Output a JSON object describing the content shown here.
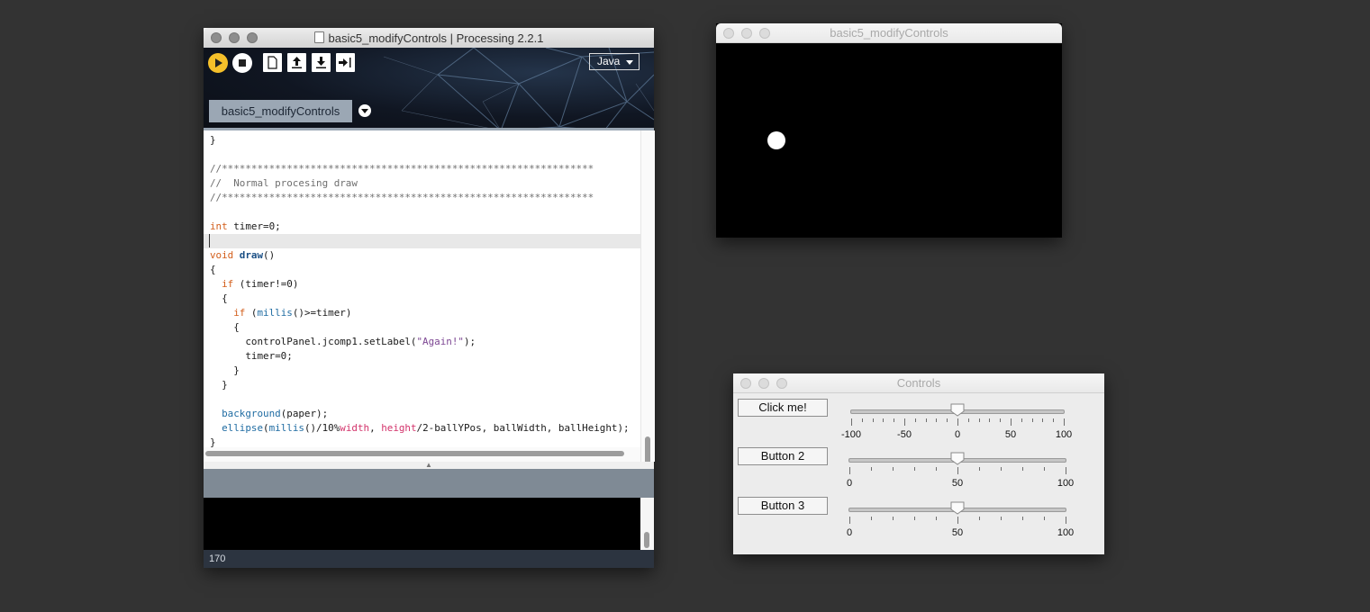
{
  "ide": {
    "title": "basic5_modifyControls | Processing 2.2.1",
    "mode": "Java",
    "tab_label": "basic5_modifyControls",
    "status_line": "170",
    "toolbar": {
      "run_icon": "play-icon",
      "stop_icon": "stop-icon",
      "new_icon": "new-sketch-icon",
      "open_icon": "open-arrow-up-icon",
      "save_icon": "save-arrow-down-icon",
      "export_icon": "export-arrow-icon",
      "accent": "#f5c02a"
    },
    "code_lines": [
      [
        {
          "t": "}",
          "c": ""
        }
      ],
      [],
      [
        {
          "t": "//***************************************************************",
          "c": "cm"
        }
      ],
      [
        {
          "t": "//  Normal procesing draw",
          "c": "cm"
        }
      ],
      [
        {
          "t": "//***************************************************************",
          "c": "cm"
        }
      ],
      [],
      [
        {
          "t": "int",
          "c": "kw"
        },
        {
          "t": " timer=0;",
          "c": ""
        }
      ],
      [],
      [
        {
          "t": "void",
          "c": "kw"
        },
        {
          "t": " ",
          "c": ""
        },
        {
          "t": "draw",
          "c": "kd"
        },
        {
          "t": "()",
          "c": ""
        }
      ],
      [
        {
          "t": "{",
          "c": ""
        }
      ],
      [
        {
          "t": "  ",
          "c": ""
        },
        {
          "t": "if",
          "c": "kw"
        },
        {
          "t": " (timer!=0)",
          "c": ""
        }
      ],
      [
        {
          "t": "  {",
          "c": ""
        }
      ],
      [
        {
          "t": "    ",
          "c": ""
        },
        {
          "t": "if",
          "c": "kw"
        },
        {
          "t": " (",
          "c": ""
        },
        {
          "t": "millis",
          "c": "kf"
        },
        {
          "t": "()>=timer)",
          "c": ""
        }
      ],
      [
        {
          "t": "    {",
          "c": ""
        }
      ],
      [
        {
          "t": "      controlPanel.jcomp1.setLabel(",
          "c": ""
        },
        {
          "t": "\"Again!\"",
          "c": "ks"
        },
        {
          "t": ");",
          "c": ""
        }
      ],
      [
        {
          "t": "      timer=0;",
          "c": ""
        }
      ],
      [
        {
          "t": "    }",
          "c": ""
        }
      ],
      [
        {
          "t": "  }",
          "c": ""
        }
      ],
      [],
      [
        {
          "t": "  ",
          "c": ""
        },
        {
          "t": "background",
          "c": "kf"
        },
        {
          "t": "(paper);",
          "c": ""
        }
      ],
      [
        {
          "t": "  ",
          "c": ""
        },
        {
          "t": "ellipse",
          "c": "kf"
        },
        {
          "t": "(",
          "c": ""
        },
        {
          "t": "millis",
          "c": "kf"
        },
        {
          "t": "()/10%",
          "c": ""
        },
        {
          "t": "width",
          "c": "kp"
        },
        {
          "t": ", ",
          "c": ""
        },
        {
          "t": "height",
          "c": "kp"
        },
        {
          "t": "/2-ballYPos, ballWidth, ballHeight);",
          "c": ""
        }
      ],
      [
        {
          "t": "}",
          "c": ""
        }
      ]
    ],
    "current_line_index": 7
  },
  "sketch": {
    "title": "basic5_modifyControls",
    "background": "#000000",
    "ball_color": "#ffffff"
  },
  "controls": {
    "title": "Controls",
    "rows": [
      {
        "button": "Click me!",
        "min": -100,
        "max": 100,
        "value": 0,
        "major": 50,
        "minor": 10,
        "labels": [
          "-100",
          "-50",
          "0",
          "50",
          "100"
        ]
      },
      {
        "button": "Button 2",
        "min": 0,
        "max": 100,
        "value": 50,
        "major": 50,
        "minor": 10,
        "labels": [
          "0",
          "50",
          "100"
        ]
      },
      {
        "button": "Button 3",
        "min": 0,
        "max": 100,
        "value": 50,
        "major": 50,
        "minor": 10,
        "labels": [
          "0",
          "50",
          "100"
        ]
      }
    ]
  }
}
